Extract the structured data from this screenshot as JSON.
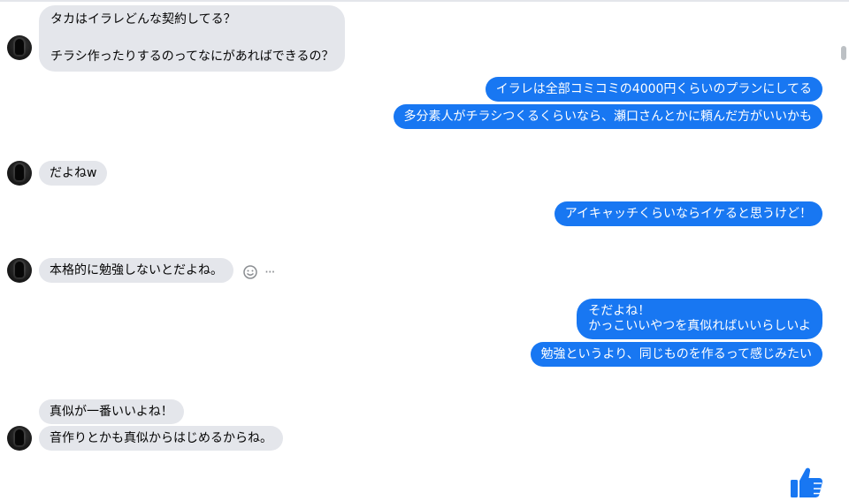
{
  "messages": [
    {
      "from": "them",
      "text": "タカはイラレどんな契約してる？\n\nチラシ作ったりするのってなにがあればできるの？"
    },
    {
      "from": "me",
      "text": "イラレは全部コミコミの4000円くらいのプランにしてる"
    },
    {
      "from": "me",
      "text": "多分素人がチラシつくるくらいなら、瀬口さんとかに頼んだ方がいいかも"
    },
    {
      "from": "them",
      "text": "だよねw"
    },
    {
      "from": "me",
      "text": "アイキャッチくらいならイケると思うけど！"
    },
    {
      "from": "them",
      "text": "本格的に勉強しないとだよね。"
    },
    {
      "from": "me",
      "text": "そだよね！\nかっこいいやつを真似ればいいらしいよ"
    },
    {
      "from": "me",
      "text": "勉強というより、同じものを作るって感じみたい"
    },
    {
      "from": "them",
      "text": "真似が一番いいよね！"
    },
    {
      "from": "them",
      "text": "音作りとかも真似からはじめるからね。"
    }
  ],
  "actions": {
    "react_icon": "smile-icon",
    "more_icon": "more-icon",
    "more_glyph": "···"
  },
  "colors": {
    "outgoing": "#1877f2",
    "incoming": "#e4e6eb",
    "like": "#1877f2"
  },
  "like_icon": "thumbs-up-icon"
}
